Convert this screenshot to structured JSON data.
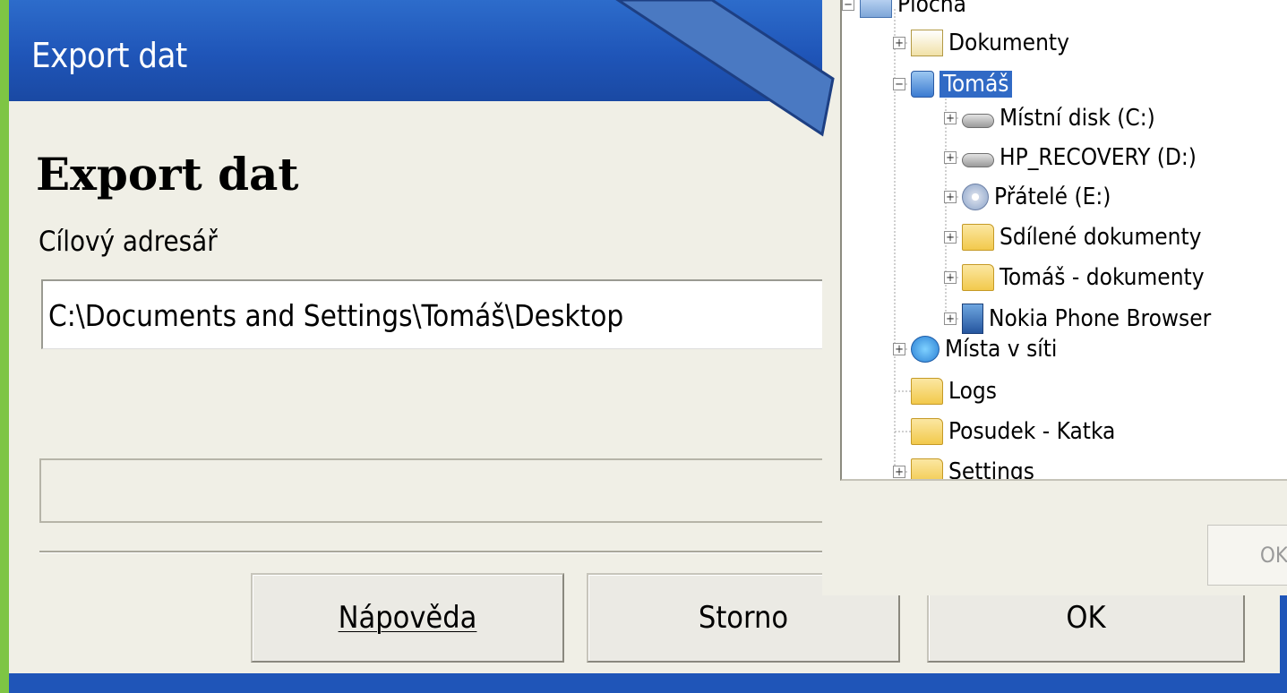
{
  "dialog": {
    "window_title": "Export dat",
    "heading": "Export dat",
    "target_dir_label": "Cílový adresář",
    "target_dir_value": "C:\\Documents and Settings\\Tomáš\\Desktop",
    "buttons": {
      "help_label": "Nápověda",
      "cancel_label": "Storno",
      "ok_label": "OK"
    }
  },
  "folder_browser": {
    "items": [
      {
        "label": "Plocha",
        "icon": "desktop-icon",
        "expander": "minus"
      },
      {
        "label": "Dokumenty",
        "icon": "documents-folder-icon",
        "expander": "plus"
      },
      {
        "label": "Tomáš",
        "icon": "computer-icon",
        "expander": "minus",
        "selected": true
      },
      {
        "label": "Místní disk (C:)",
        "icon": "hard-drive-icon",
        "expander": "plus"
      },
      {
        "label": "HP_RECOVERY (D:)",
        "icon": "hard-drive-icon",
        "expander": "plus"
      },
      {
        "label": "Přátelé (E:)",
        "icon": "cd-drive-icon",
        "expander": "plus"
      },
      {
        "label": "Sdílené dokumenty",
        "icon": "folder-icon",
        "expander": "plus"
      },
      {
        "label": "Tomáš - dokumenty",
        "icon": "folder-icon",
        "expander": "plus"
      },
      {
        "label": "Nokia Phone Browser",
        "icon": "phone-icon",
        "expander": "plus"
      },
      {
        "label": "Místa v síti",
        "icon": "network-icon",
        "expander": "plus"
      },
      {
        "label": "Logs",
        "icon": "folder-icon",
        "expander": "none"
      },
      {
        "label": "Posudek - Katka",
        "icon": "folder-icon",
        "expander": "none"
      },
      {
        "label": "Settings",
        "icon": "folder-icon",
        "expander": "plus"
      }
    ],
    "ok_label": "OK"
  },
  "colors": {
    "background_green": "#7ec544",
    "titlebar_blue": "#1f55b8",
    "selection_blue": "#316ac5",
    "dialog_face": "#f0efe6"
  }
}
